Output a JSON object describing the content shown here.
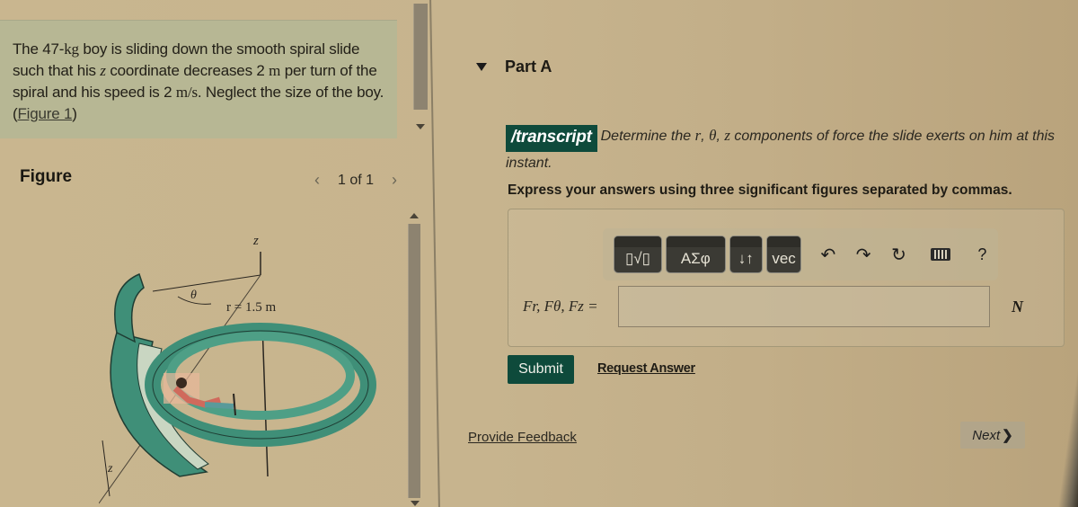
{
  "problem": {
    "text_before_kg": "The 47-",
    "kg_unit": "kg",
    "text_after_kg": " boy is sliding down the smooth spiral slide such that his ",
    "z_var": "z",
    "text_mid": " coordinate decreases 2 ",
    "m_unit": "m",
    "text_mid2": " per turn of the spiral and his speed is 2 ",
    "speed_unit": "m/s",
    "text_end": ". Neglect the size of the boy. (",
    "figure_link": "Figure 1",
    "close_paren": ")"
  },
  "figure": {
    "header": "Figure",
    "pager": "1 of 1",
    "prev_icon": "chevron-left-icon",
    "next_icon": "chevron-right-icon",
    "labels": {
      "z_axis": "z",
      "theta": "θ",
      "radius": "r = 1.5 m",
      "z_height": "z"
    }
  },
  "part": {
    "title": "Part A",
    "transcript_badge": "/transcript",
    "question_pre": "Determine the ",
    "var_r": "r",
    "var_theta": "θ",
    "var_z": "z",
    "question_post": " components of force the slide exerts on him at this instant.",
    "instruction": "Express your answers using three significant figures separated by commas."
  },
  "toolbar": {
    "templates_label": "▯√▯",
    "greek_label": "ΑΣφ",
    "arrows_label": "↓↑",
    "vec_label": "vec",
    "undo_icon": "undo-icon",
    "redo_icon": "redo-icon",
    "reset_icon": "reset-icon",
    "keyboard_icon": "keyboard-icon",
    "help_label": "?"
  },
  "answer": {
    "label": "Fr, Fθ, Fz =",
    "value": "",
    "placeholder": "",
    "unit": "N"
  },
  "actions": {
    "submit": "Submit",
    "request_answer": "Request Answer",
    "provide_feedback": "Provide Feedback",
    "next": "Next",
    "next_chevron": "❯"
  },
  "colors": {
    "accent": "#0e4a3b",
    "problem_bg": "#b7b794",
    "slide_green": "#3f8f78"
  }
}
